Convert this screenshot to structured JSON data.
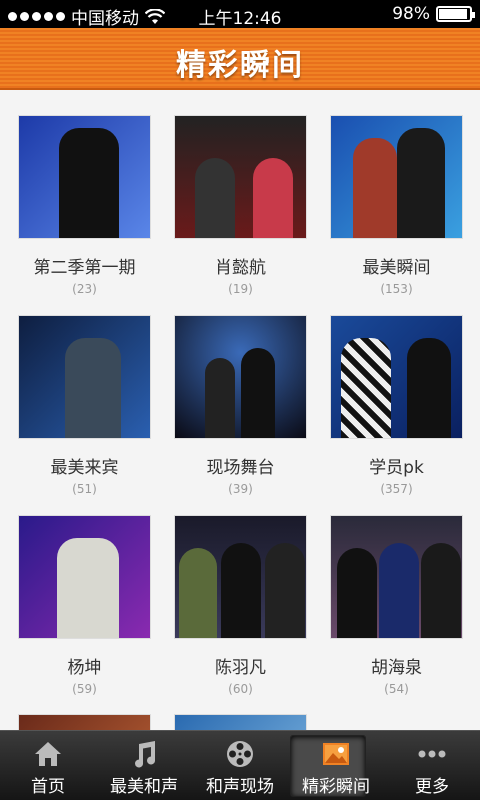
{
  "status": {
    "carrier": "中国移动",
    "time": "上午12:46",
    "battery": "98%"
  },
  "header": {
    "title": "精彩瞬间"
  },
  "items": [
    {
      "name": "第二季第一期",
      "count": "(23)"
    },
    {
      "name": "肖懿航",
      "count": "(19)"
    },
    {
      "name": "最美瞬间",
      "count": "(153)"
    },
    {
      "name": "最美来宾",
      "count": "(51)"
    },
    {
      "name": "现场舞台",
      "count": "(39)"
    },
    {
      "name": "学员pk",
      "count": "(357)"
    },
    {
      "name": "杨坤",
      "count": "(59)"
    },
    {
      "name": "陈羽凡",
      "count": "(60)"
    },
    {
      "name": "胡海泉",
      "count": "(54)"
    }
  ],
  "tabs": [
    {
      "label": "首页",
      "icon": "home-icon"
    },
    {
      "label": "最美和声",
      "icon": "music-note-icon"
    },
    {
      "label": "和声现场",
      "icon": "film-reel-icon"
    },
    {
      "label": "精彩瞬间",
      "icon": "photo-icon"
    },
    {
      "label": "更多",
      "icon": "more-dots-icon"
    }
  ],
  "colors": {
    "header": "#f08224",
    "tabbar": "#1e1e1e"
  }
}
